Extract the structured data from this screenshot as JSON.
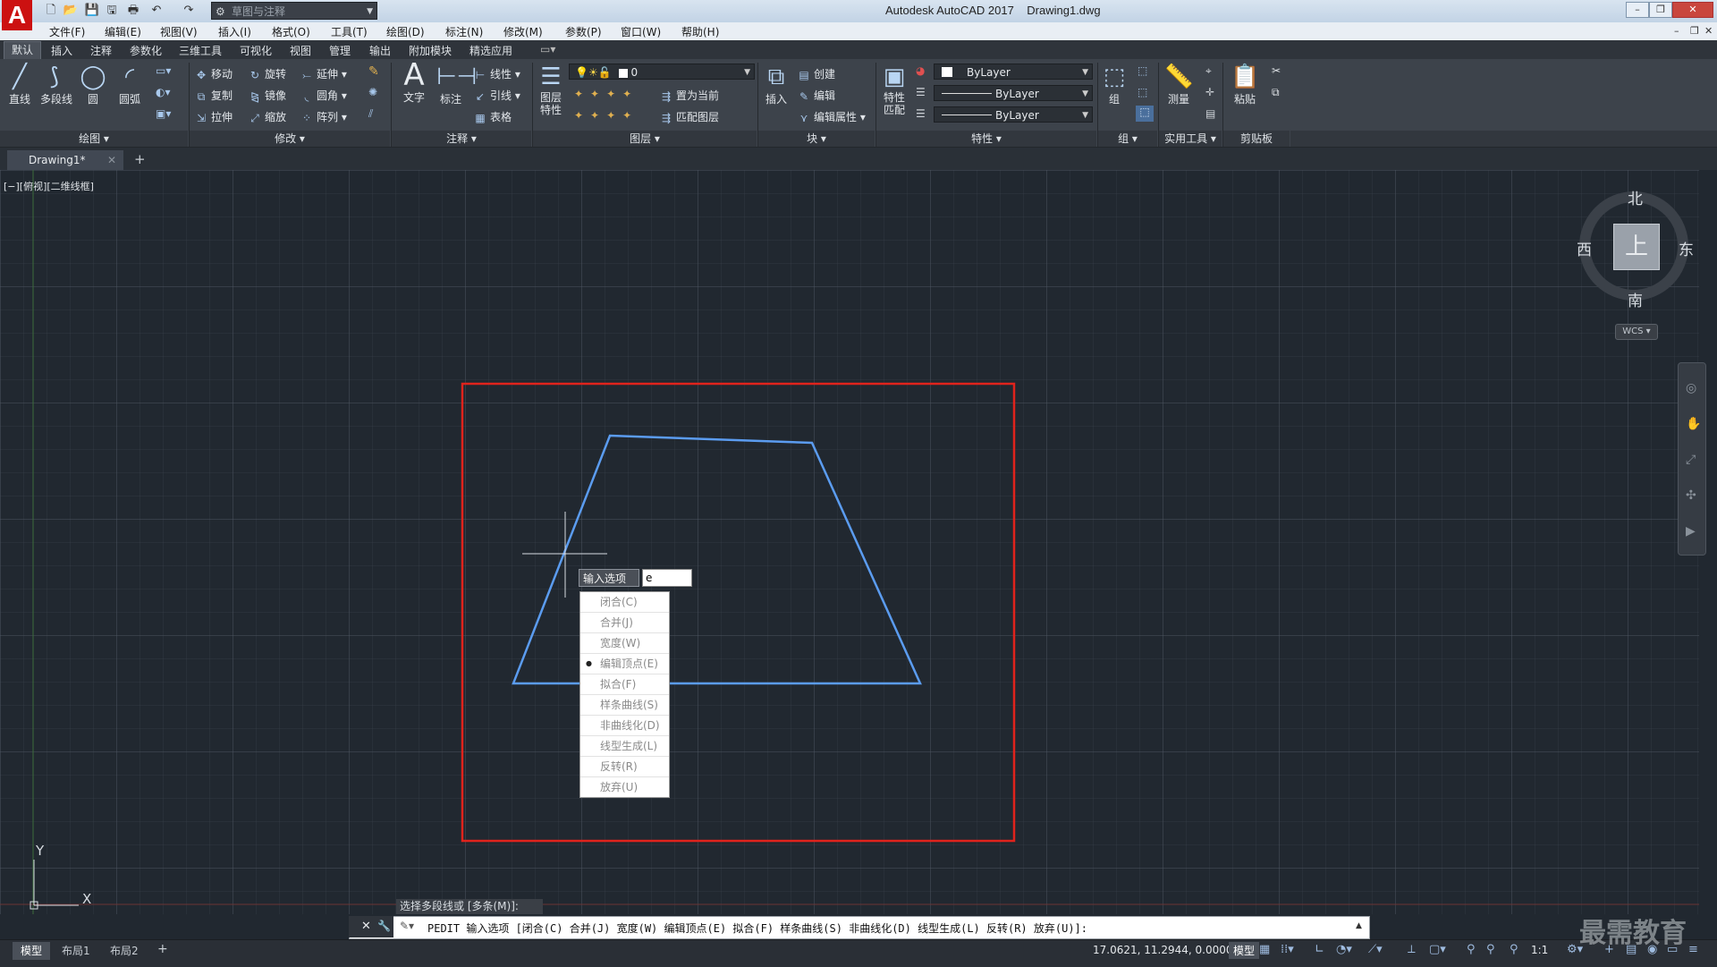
{
  "titlebar": {
    "app_title": "Autodesk AutoCAD 2017",
    "file_name": "Drawing1.dwg",
    "workspace": "草图与注释",
    "logo_letter": "A"
  },
  "menubar": {
    "items": [
      "文件(F)",
      "编辑(E)",
      "视图(V)",
      "插入(I)",
      "格式(O)",
      "工具(T)",
      "绘图(D)",
      "标注(N)",
      "修改(M)",
      "参数(P)",
      "窗口(W)",
      "帮助(H)"
    ]
  },
  "ribbon_tabs": [
    "默认",
    "插入",
    "注释",
    "参数化",
    "三维工具",
    "可视化",
    "视图",
    "管理",
    "输出",
    "附加模块",
    "精选应用"
  ],
  "ribbon": {
    "draw": {
      "label": "绘图",
      "line": "直线",
      "polyline": "多段线",
      "circle": "圆",
      "arc": "圆弧"
    },
    "modify": {
      "label": "修改",
      "move": "移动",
      "rotate": "旋转",
      "extend": "延伸",
      "copy": "复制",
      "mirror": "镜像",
      "fillet": "圆角",
      "stretch": "拉伸",
      "scale": "缩放",
      "array": "阵列"
    },
    "annotation": {
      "label": "注释",
      "text": "文字",
      "dimension": "标注",
      "linear": "线性",
      "leader": "引线",
      "table": "表格"
    },
    "layers": {
      "label": "图层",
      "layer_props": "图层\n特性",
      "layer_props_l1": "图层",
      "layer_props_l2": "特性",
      "current_layer": "0",
      "set_current": "置为当前",
      "match_layer": "匹配图层"
    },
    "block": {
      "label": "块",
      "insert": "插入",
      "create": "创建",
      "edit": "编辑",
      "edit_attr": "编辑属性"
    },
    "properties": {
      "label": "特性",
      "match_l1": "特性",
      "match_l2": "匹配",
      "color": "ByLayer",
      "linetype": "ByLayer",
      "lineweight": "ByLayer"
    },
    "groups": {
      "label": "组",
      "group": "组"
    },
    "utilities": {
      "label": "实用工具",
      "measure": "测量"
    },
    "clipboard": {
      "label": "剪贴板",
      "paste": "粘贴"
    }
  },
  "file_tab": {
    "name": "Drawing1*"
  },
  "viewport_label": "[−][俯视][二维线框]",
  "viewcube": {
    "north": "北",
    "south": "南",
    "east": "东",
    "west": "西",
    "face": "上",
    "wcs": "WCS"
  },
  "dynamic_input": {
    "label": "输入选项",
    "value": "e",
    "options": [
      "闭合(C)",
      "合并(J)",
      "宽度(W)",
      "编辑顶点(E)",
      "拟合(F)",
      "样条曲线(S)",
      "非曲线化(D)",
      "线型生成(L)",
      "反转(R)",
      "放弃(U)"
    ],
    "selected": "编辑顶点(E)"
  },
  "ucs": {
    "x": "X",
    "y": "Y"
  },
  "command": {
    "history": "选择多段线或 [多条(M)]:",
    "prompt": "PEDIT 输入选项 [闭合(C) 合并(J) 宽度(W) 编辑顶点(E) 拟合(F) 样条曲线(S) 非曲线化(D) 线型生成(L) 反转(R) 放弃(U)]:"
  },
  "layout_tabs": [
    "模型",
    "布局1",
    "布局2"
  ],
  "status": {
    "coords": "17.0621, 11.2944, 0.0000",
    "space": "模型",
    "scale": "1:1"
  },
  "watermark": "最需教育",
  "colors": {
    "canvas": "#212830",
    "polyline": "#5b9cf0",
    "highlight_box": "#e0231c"
  }
}
